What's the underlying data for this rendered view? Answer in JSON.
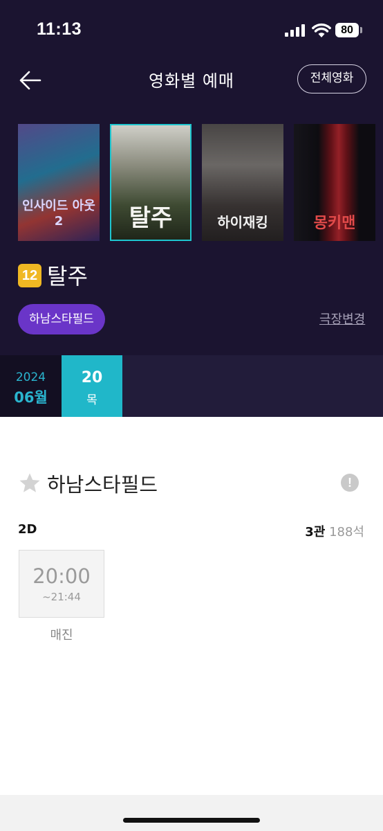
{
  "status_bar": {
    "time": "11:13",
    "battery": "80"
  },
  "header": {
    "title": "영화별 예매",
    "all_movies_label": "전체영화"
  },
  "posters": [
    {
      "title": "인사이드 아웃2"
    },
    {
      "title": "탈주"
    },
    {
      "title": "하이재킹"
    },
    {
      "title": "몽키맨"
    }
  ],
  "movie": {
    "age_rating": "12",
    "title": "탈주"
  },
  "theater_select": {
    "selected": "하남스타필드",
    "change_label": "극장변경"
  },
  "date": {
    "year": "2024",
    "month": "06월",
    "day": "20",
    "weekday": "목"
  },
  "theater": {
    "name": "하남스타필드"
  },
  "screening": {
    "format": "2D",
    "hall": "3관",
    "seats": "188석",
    "showtimes": [
      {
        "start": "20:00",
        "end": "~21:44",
        "status": "매진"
      }
    ]
  }
}
